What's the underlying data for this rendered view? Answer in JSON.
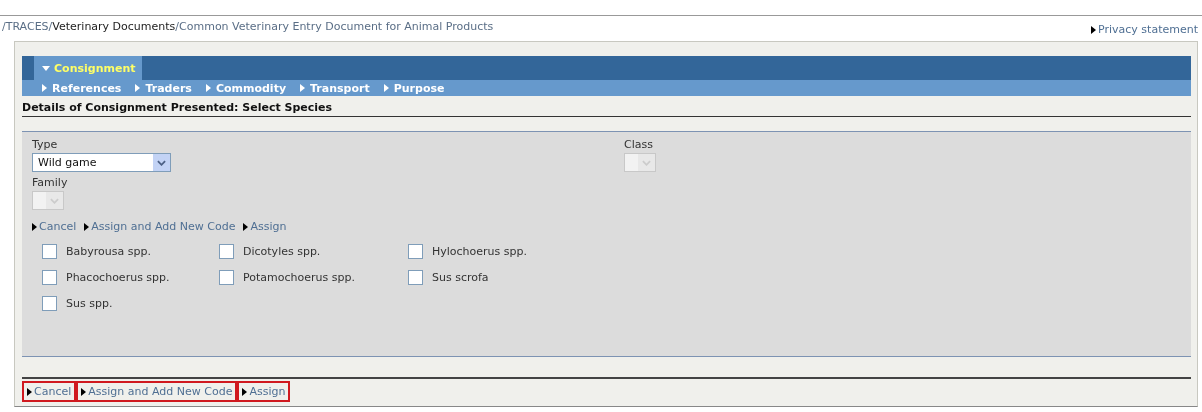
{
  "breadcrumb": [
    {
      "label": "/TRACES/",
      "kind": "link"
    },
    {
      "label": "Veterinary Documents",
      "kind": "plain"
    },
    {
      "label": "/Common Veterinary Entry Document for Animal Products",
      "kind": "link"
    }
  ],
  "privacy_link": "Privacy statement",
  "nav": {
    "section": {
      "label": "Consignment",
      "expanded": true
    },
    "items": [
      {
        "label": "References"
      },
      {
        "label": "Traders"
      },
      {
        "label": "Commodity"
      },
      {
        "label": "Transport"
      },
      {
        "label": "Purpose"
      }
    ]
  },
  "heading": "Details of Consignment Presented: Select Species",
  "form": {
    "type": {
      "label": "Type",
      "value": "Wild game",
      "disabled": false
    },
    "class": {
      "label": "Class",
      "disabled": true
    },
    "family": {
      "label": "Family",
      "disabled": true
    }
  },
  "inner_actions": [
    {
      "label": "Cancel",
      "highlighted": false
    },
    {
      "label": "Assign and Add New Code",
      "highlighted": false
    },
    {
      "label": "Assign",
      "highlighted": false
    }
  ],
  "species": [
    {
      "label": "Babyrousa spp.",
      "checked": false
    },
    {
      "label": "Dicotyles spp.",
      "checked": false
    },
    {
      "label": "Hylochoerus spp.",
      "checked": false
    },
    {
      "label": "Phacochoerus spp.",
      "checked": false
    },
    {
      "label": "Potamochoerus spp.",
      "checked": false
    },
    {
      "label": "Sus scrofa",
      "checked": false
    },
    {
      "label": "Sus spp.",
      "checked": false
    }
  ],
  "bottom_actions": [
    {
      "label": "Cancel",
      "highlighted": true
    },
    {
      "label": "Assign and Add New Code",
      "highlighted": true
    },
    {
      "label": "Assign",
      "highlighted": true
    }
  ]
}
